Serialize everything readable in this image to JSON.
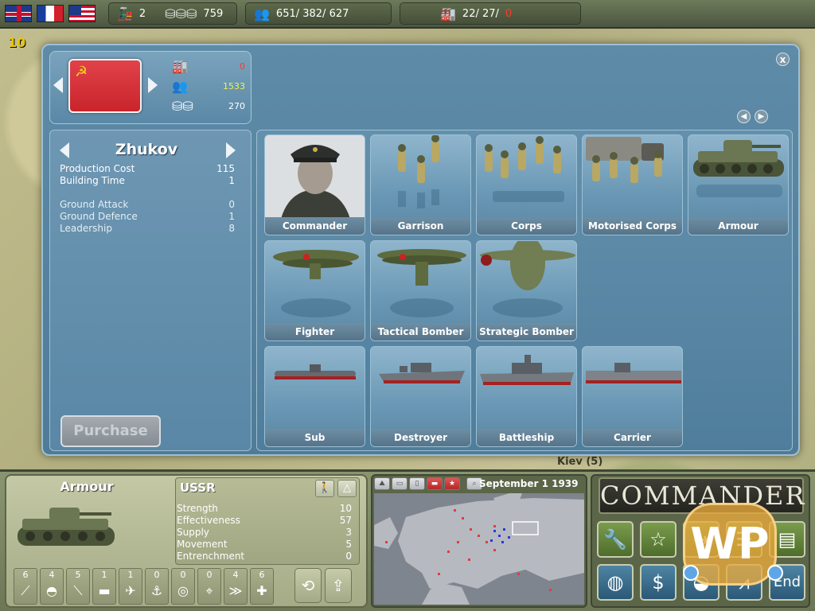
{
  "topbar": {
    "flags": [
      "UK",
      "France",
      "USA"
    ],
    "trains": "2",
    "money": "759",
    "manpower": "651/  382/  627",
    "industry": "22/  27/",
    "industry_red": "0"
  },
  "dialog": {
    "close_label": "x",
    "nation": {
      "industry": "0",
      "manpower": "1533",
      "money": "270"
    },
    "unit": {
      "name": "Zhukov",
      "production_cost_label": "Production Cost",
      "production_cost": "115",
      "building_time_label": "Building Time",
      "building_time": "1",
      "ground_attack_label": "Ground Attack",
      "ground_attack": "0",
      "ground_defence_label": "Ground Defence",
      "ground_defence": "1",
      "leadership_label": "Leadership",
      "leadership": "8"
    },
    "purchase_label": "Purchase",
    "units": [
      {
        "label": "Commander",
        "kind": "commander"
      },
      {
        "label": "Garrison",
        "kind": "infantry"
      },
      {
        "label": "Corps",
        "kind": "infantry"
      },
      {
        "label": "Motorised Corps",
        "kind": "motorised"
      },
      {
        "label": "Armour",
        "kind": "tank"
      },
      {
        "label": "Fighter",
        "kind": "plane"
      },
      {
        "label": "Tactical Bomber",
        "kind": "plane"
      },
      {
        "label": "Strategic Bomber",
        "kind": "bomber"
      },
      {
        "label": "Sub",
        "kind": "ship"
      },
      {
        "label": "Destroyer",
        "kind": "ship"
      },
      {
        "label": "Battleship",
        "kind": "ship"
      },
      {
        "label": "Carrier",
        "kind": "carrier"
      }
    ]
  },
  "hud": {
    "unit_title": "Armour",
    "nation": "USSR",
    "stats": [
      {
        "label": "Strength",
        "value": "10"
      },
      {
        "label": "Effectiveness",
        "value": "57"
      },
      {
        "label": "Supply",
        "value": "3"
      },
      {
        "label": "Movement",
        "value": "5"
      },
      {
        "label": "Entrenchment",
        "value": "0"
      }
    ],
    "slots": [
      {
        "num": "6",
        "icon": "rifle-icon",
        "sym": "⟋"
      },
      {
        "num": "4",
        "icon": "helmet-icon",
        "sym": "◓"
      },
      {
        "num": "5",
        "icon": "artillery-icon",
        "sym": "⟍"
      },
      {
        "num": "1",
        "icon": "tank-icon",
        "sym": "▬"
      },
      {
        "num": "1",
        "icon": "plane-icon",
        "sym": "✈"
      },
      {
        "num": "0",
        "icon": "anchor-icon",
        "sym": "⚓"
      },
      {
        "num": "0",
        "icon": "radar-icon",
        "sym": "◎"
      },
      {
        "num": "0",
        "icon": "crosshair-icon",
        "sym": "⌖"
      },
      {
        "num": "4",
        "icon": "rank-icon",
        "sym": "≫"
      },
      {
        "num": "6",
        "icon": "medic-icon",
        "sym": "✚"
      }
    ],
    "date": "September 1 1939",
    "commander_title": "COMMANDER",
    "end_label": "End",
    "watermark": "WP"
  },
  "map_labels": {
    "top_left": "10",
    "bottom_city": "Kiev (5)"
  },
  "colors": {
    "dialog": "#5b87a4",
    "ussr_red": "#d3333a",
    "hud_olive": "#7c8663"
  }
}
